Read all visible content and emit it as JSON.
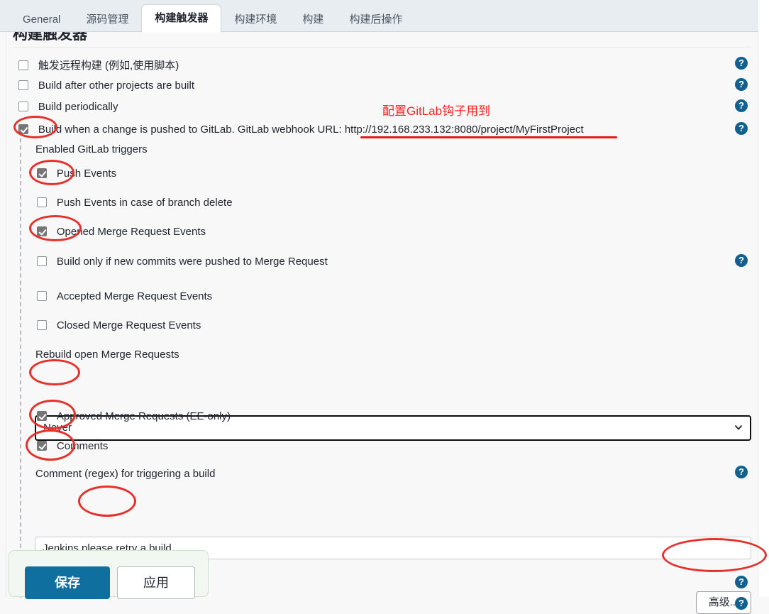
{
  "window": {
    "section_heading": "构建触发器"
  },
  "tabs": [
    {
      "label": "General",
      "active": false
    },
    {
      "label": "源码管理",
      "active": false
    },
    {
      "label": "构建触发器",
      "active": true
    },
    {
      "label": "构建环境",
      "active": false
    },
    {
      "label": "构建",
      "active": false
    },
    {
      "label": "构建后操作",
      "active": false
    }
  ],
  "triggers": {
    "remote_build": "触发远程构建 (例如,使用脚本)",
    "after_other_projects": "Build after other projects are built",
    "periodically": "Build periodically",
    "gitlab_push": "Build when a change is pushed to GitLab. GitLab webhook URL: http://192.168.233.132:8080/project/MyFirstProject",
    "gitlab_webhook_url": "http://192.168.233.132:8080/project/MyFirstProject",
    "enabled_triggers_label": "Enabled GitLab triggers",
    "push_events": "Push Events",
    "push_events_branch_delete": "Push Events in case of branch delete",
    "opened_mr_events": "Opened Merge Request Events",
    "build_only_new_commits": "Build only if new commits were pushed to Merge Request",
    "accepted_mr_events": "Accepted Merge Request Events",
    "closed_mr_events": "Closed Merge Request Events",
    "rebuild_open_mr_label": "Rebuild open Merge Requests",
    "rebuild_open_mr_value": "Never",
    "approved_mr": "Approved Merge Requests (EE-only)",
    "comments": "Comments",
    "comment_regex_label": "Comment (regex) for triggering a build",
    "comment_regex_value": "Jenkins please retry a build"
  },
  "buttons": {
    "advanced": "高级...",
    "save": "保存",
    "apply": "应用"
  },
  "icons": {
    "help": "?"
  },
  "annotation": {
    "note_text": "配置GitLab钩子用到",
    "color": "#ff1d1d"
  },
  "colors": {
    "accent_blue": "#0f6f9e",
    "help_blue": "#11618f",
    "annotation_red": "#e8302a",
    "tabbar_bg": "#e8edf1",
    "page_bg": "#f8f8f8",
    "checked_checkbox": "#767676"
  }
}
